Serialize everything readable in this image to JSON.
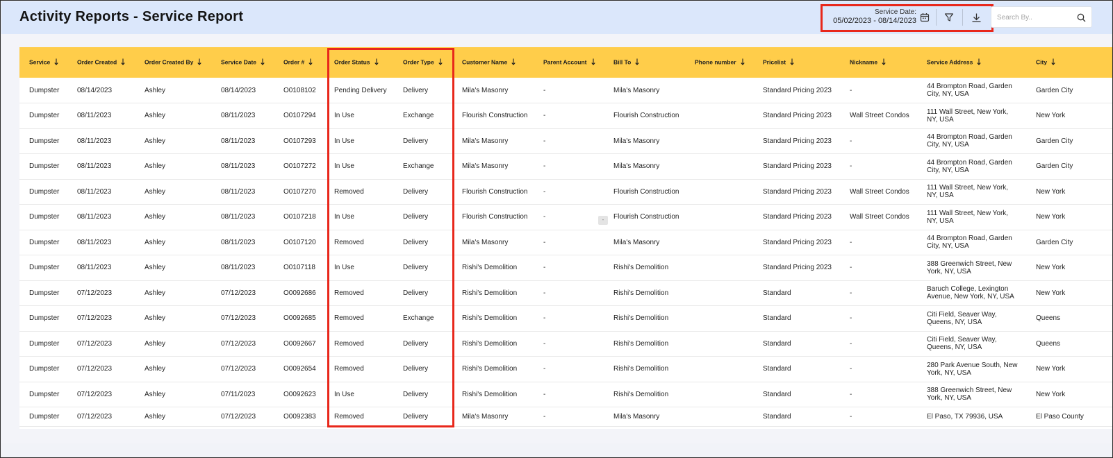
{
  "header": {
    "title": "Activity Reports - Service Report",
    "service_date_label": "Service Date:",
    "service_date_range": "05/02/2023 - 08/14/2023",
    "search_placeholder": "Search By..",
    "icons": [
      "calendar-icon",
      "filter-icon",
      "download-icon",
      "search-icon"
    ]
  },
  "table": {
    "columns": [
      "Service",
      "Order Created",
      "Order Created By",
      "Service Date",
      "Order #",
      "Order Status",
      "Order Type",
      "Customer Name",
      "Parent Account",
      "Bill To",
      "Phone number",
      "Pricelist",
      "Nickname",
      "Service Address",
      "City"
    ],
    "rows": [
      [
        "Dumpster",
        "08/14/2023",
        "Ashley",
        "08/14/2023",
        "O0108102",
        "Pending Delivery",
        "Delivery",
        "Mila's Masonry",
        "-",
        "Mila's Masonry",
        "",
        "Standard Pricing 2023",
        "-",
        "44 Brompton Road, Garden City, NY, USA",
        "Garden City"
      ],
      [
        "Dumpster",
        "08/11/2023",
        "Ashley",
        "08/11/2023",
        "O0107294",
        "In Use",
        "Exchange",
        "Flourish Construction",
        "-",
        "Flourish Construction",
        "",
        "Standard Pricing 2023",
        "Wall Street Condos",
        "111 Wall Street, New York, NY, USA",
        "New York"
      ],
      [
        "Dumpster",
        "08/11/2023",
        "Ashley",
        "08/11/2023",
        "O0107293",
        "In Use",
        "Delivery",
        "Mila's Masonry",
        "-",
        "Mila's Masonry",
        "",
        "Standard Pricing 2023",
        "-",
        "44 Brompton Road, Garden City, NY, USA",
        "Garden City"
      ],
      [
        "Dumpster",
        "08/11/2023",
        "Ashley",
        "08/11/2023",
        "O0107272",
        "In Use",
        "Exchange",
        "Mila's Masonry",
        "-",
        "Mila's Masonry",
        "",
        "Standard Pricing 2023",
        "-",
        "44 Brompton Road, Garden City, NY, USA",
        "Garden City"
      ],
      [
        "Dumpster",
        "08/11/2023",
        "Ashley",
        "08/11/2023",
        "O0107270",
        "Removed",
        "Delivery",
        "Flourish Construction",
        "-",
        "Flourish Construction",
        "",
        "Standard Pricing 2023",
        "Wall Street Condos",
        "111 Wall Street, New York, NY, USA",
        "New York"
      ],
      [
        "Dumpster",
        "08/11/2023",
        "Ashley",
        "08/11/2023",
        "O0107218",
        "In Use",
        "Delivery",
        "Flourish Construction",
        "-",
        "Flourish Construction",
        "",
        "Standard Pricing 2023",
        "Wall Street Condos",
        "111 Wall Street, New York, NY, USA",
        "New York"
      ],
      [
        "Dumpster",
        "08/11/2023",
        "Ashley",
        "08/11/2023",
        "O0107120",
        "Removed",
        "Delivery",
        "Mila's Masonry",
        "-",
        "Mila's Masonry",
        "",
        "Standard Pricing 2023",
        "-",
        "44 Brompton Road, Garden City, NY, USA",
        "Garden City"
      ],
      [
        "Dumpster",
        "08/11/2023",
        "Ashley",
        "08/11/2023",
        "O0107118",
        "In Use",
        "Delivery",
        "Rishi's Demolition",
        "-",
        "Rishi's Demolition",
        "",
        "Standard Pricing 2023",
        "-",
        "388 Greenwich Street, New York, NY, USA",
        "New York"
      ],
      [
        "Dumpster",
        "07/12/2023",
        "Ashley",
        "07/12/2023",
        "O0092686",
        "Removed",
        "Delivery",
        "Rishi's Demolition",
        "-",
        "Rishi's Demolition",
        "",
        "Standard",
        "-",
        "Baruch College, Lexington Avenue, New York, NY, USA",
        "New York"
      ],
      [
        "Dumpster",
        "07/12/2023",
        "Ashley",
        "07/12/2023",
        "O0092685",
        "Removed",
        "Exchange",
        "Rishi's Demolition",
        "-",
        "Rishi's Demolition",
        "",
        "Standard",
        "-",
        "Citi Field, Seaver Way, Queens, NY, USA",
        "Queens"
      ],
      [
        "Dumpster",
        "07/12/2023",
        "Ashley",
        "07/12/2023",
        "O0092667",
        "Removed",
        "Delivery",
        "Rishi's Demolition",
        "-",
        "Rishi's Demolition",
        "",
        "Standard",
        "-",
        "Citi Field, Seaver Way, Queens, NY, USA",
        "Queens"
      ],
      [
        "Dumpster",
        "07/12/2023",
        "Ashley",
        "07/12/2023",
        "O0092654",
        "Removed",
        "Delivery",
        "Rishi's Demolition",
        "-",
        "Rishi's Demolition",
        "",
        "Standard",
        "-",
        "280 Park Avenue South, New York, NY, USA",
        "New York"
      ],
      [
        "Dumpster",
        "07/12/2023",
        "Ashley",
        "07/11/2023",
        "O0092623",
        "In Use",
        "Delivery",
        "Rishi's Demolition",
        "-",
        "Rishi's Demolition",
        "",
        "Standard",
        "-",
        "388 Greenwich Street, New York, NY, USA",
        "New York"
      ],
      [
        "Dumpster",
        "07/12/2023",
        "Ashley",
        "07/12/2023",
        "O0092383",
        "Removed",
        "Delivery",
        "Mila's Masonry",
        "-",
        "Mila's Masonry",
        "",
        "Standard",
        "-",
        "El Paso, TX 79936, USA",
        "El Paso County"
      ]
    ],
    "floating_chip": "-"
  },
  "colors": {
    "header_bg": "#dbe7fb",
    "table_header_bg": "#ffcd4a",
    "highlight_border": "#e8271b"
  }
}
